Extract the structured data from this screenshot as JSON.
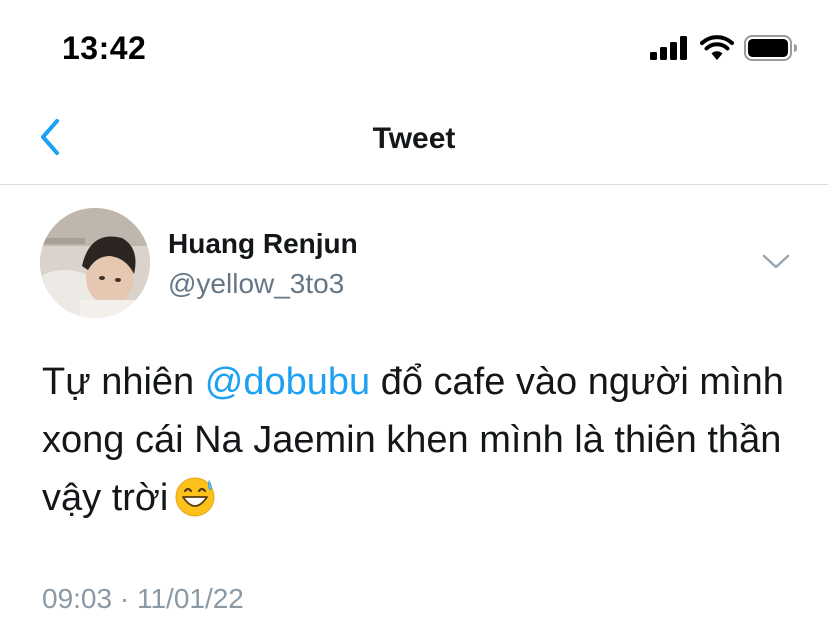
{
  "status_bar": {
    "time": "13:42",
    "icons": [
      "cellular-signal-icon",
      "wifi-icon",
      "battery-icon"
    ]
  },
  "nav": {
    "back_icon": "chevron-left-icon",
    "title": "Tweet"
  },
  "tweet": {
    "author": {
      "name": "Huang Renjun",
      "handle": "@yellow_3to3",
      "avatar_icon": "user-avatar"
    },
    "more_icon": "chevron-down-icon",
    "text": {
      "part1": "Tự nhiên ",
      "mention": "@dobubu",
      "part2": " đổ cafe vào người mình xong cái Na Jaemin khen mình là thiên thần vậy trời",
      "emoji": "grinning-face-with-sweat-emoji"
    },
    "time": "09:03",
    "separator": "·",
    "date": "11/01/22"
  },
  "colors": {
    "accent": "#1da1f2",
    "text_primary": "#14171a",
    "text_secondary": "#657786",
    "divider": "#d8dde1"
  }
}
